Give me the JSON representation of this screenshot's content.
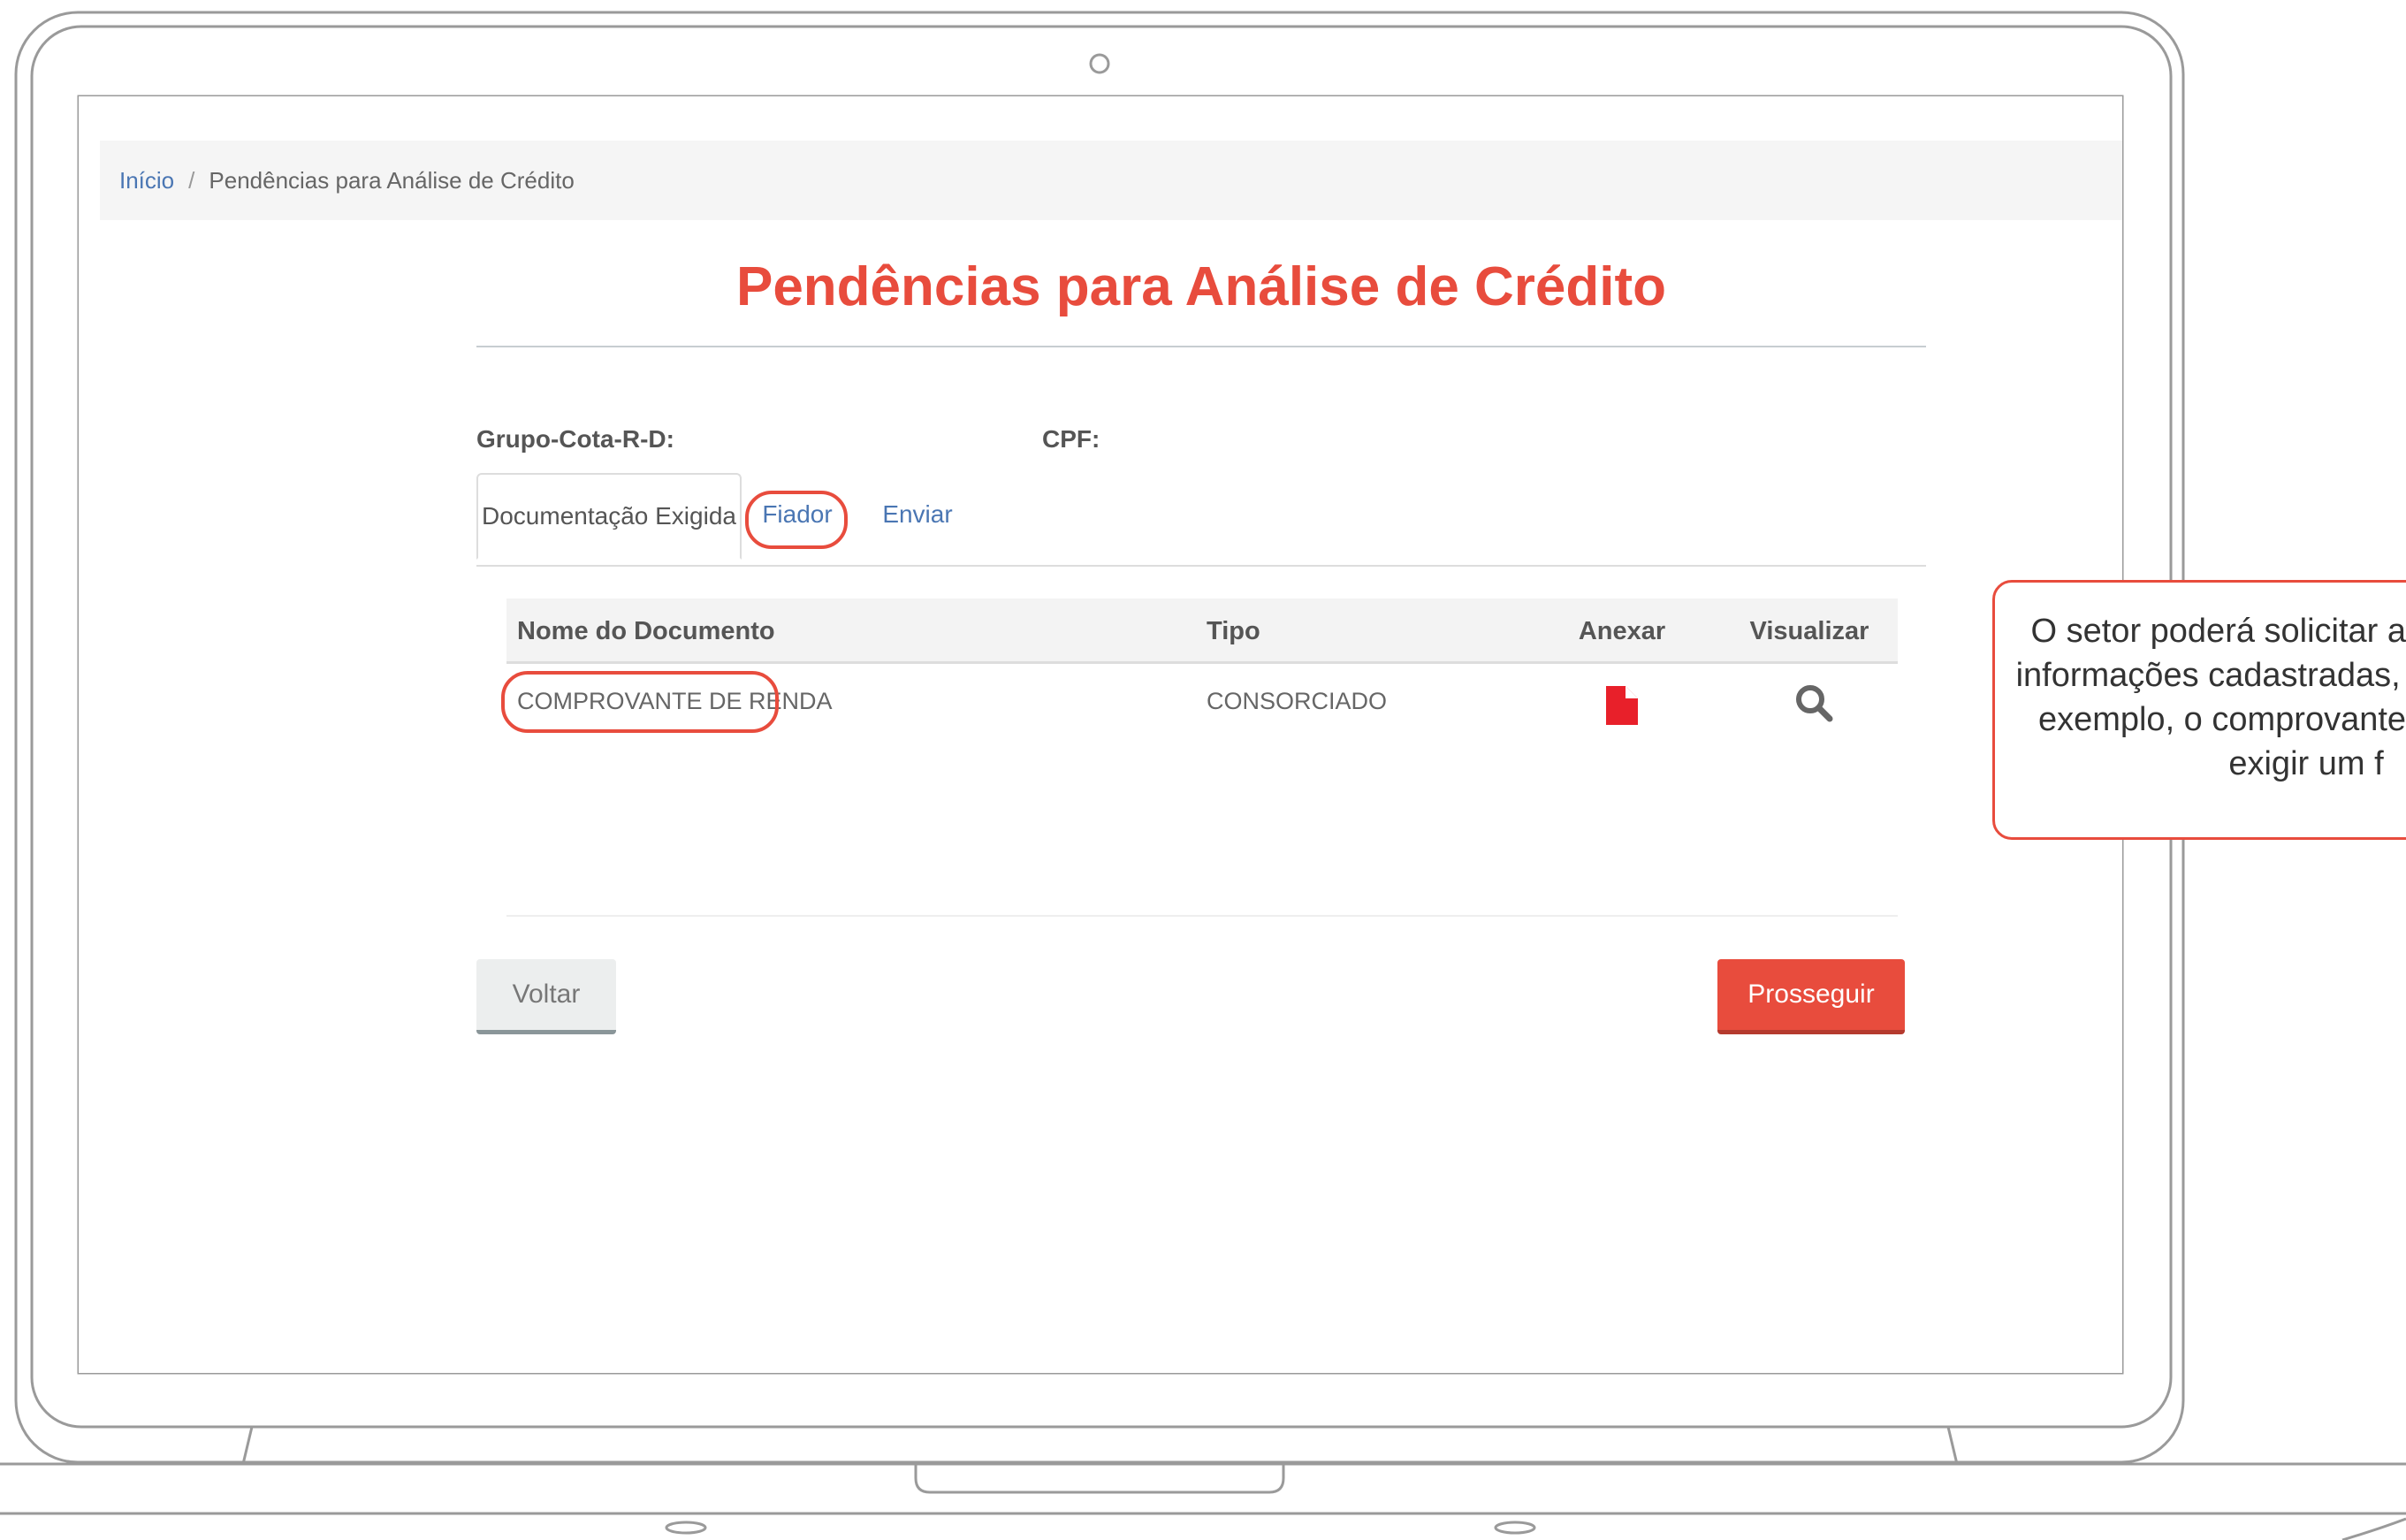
{
  "breadcrumb": {
    "home": "Início",
    "separator": "/",
    "current": "Pendências para Análise de Crédito"
  },
  "page_title": "Pendências para Análise de Crédito",
  "fields": {
    "group_label": "Grupo-Cota-R-D:",
    "cpf_label": "CPF:"
  },
  "tabs": [
    {
      "label": "Documentação Exigida",
      "active": true
    },
    {
      "label": "Fiador",
      "active": false,
      "highlighted": true
    },
    {
      "label": "Enviar",
      "active": false
    }
  ],
  "table": {
    "headers": [
      "Nome do Documento",
      "Tipo",
      "Anexar",
      "Visualizar"
    ],
    "rows": [
      {
        "name": "COMPROVANTE DE RENDA",
        "type": "CONSORCIADO",
        "attach_icon": "file-icon",
        "view_icon": "search-icon"
      }
    ]
  },
  "buttons": {
    "back": "Voltar",
    "proceed": "Prosseguir"
  },
  "callout": {
    "line1": "O setor poderá solicitar al",
    "line2": "informações cadastradas, a",
    "line3": "exemplo, o comprovante",
    "line4": "exigir um f"
  },
  "colors": {
    "accent": "#e84c3d",
    "link": "#4a76b3",
    "icon_red": "#e8202a"
  }
}
